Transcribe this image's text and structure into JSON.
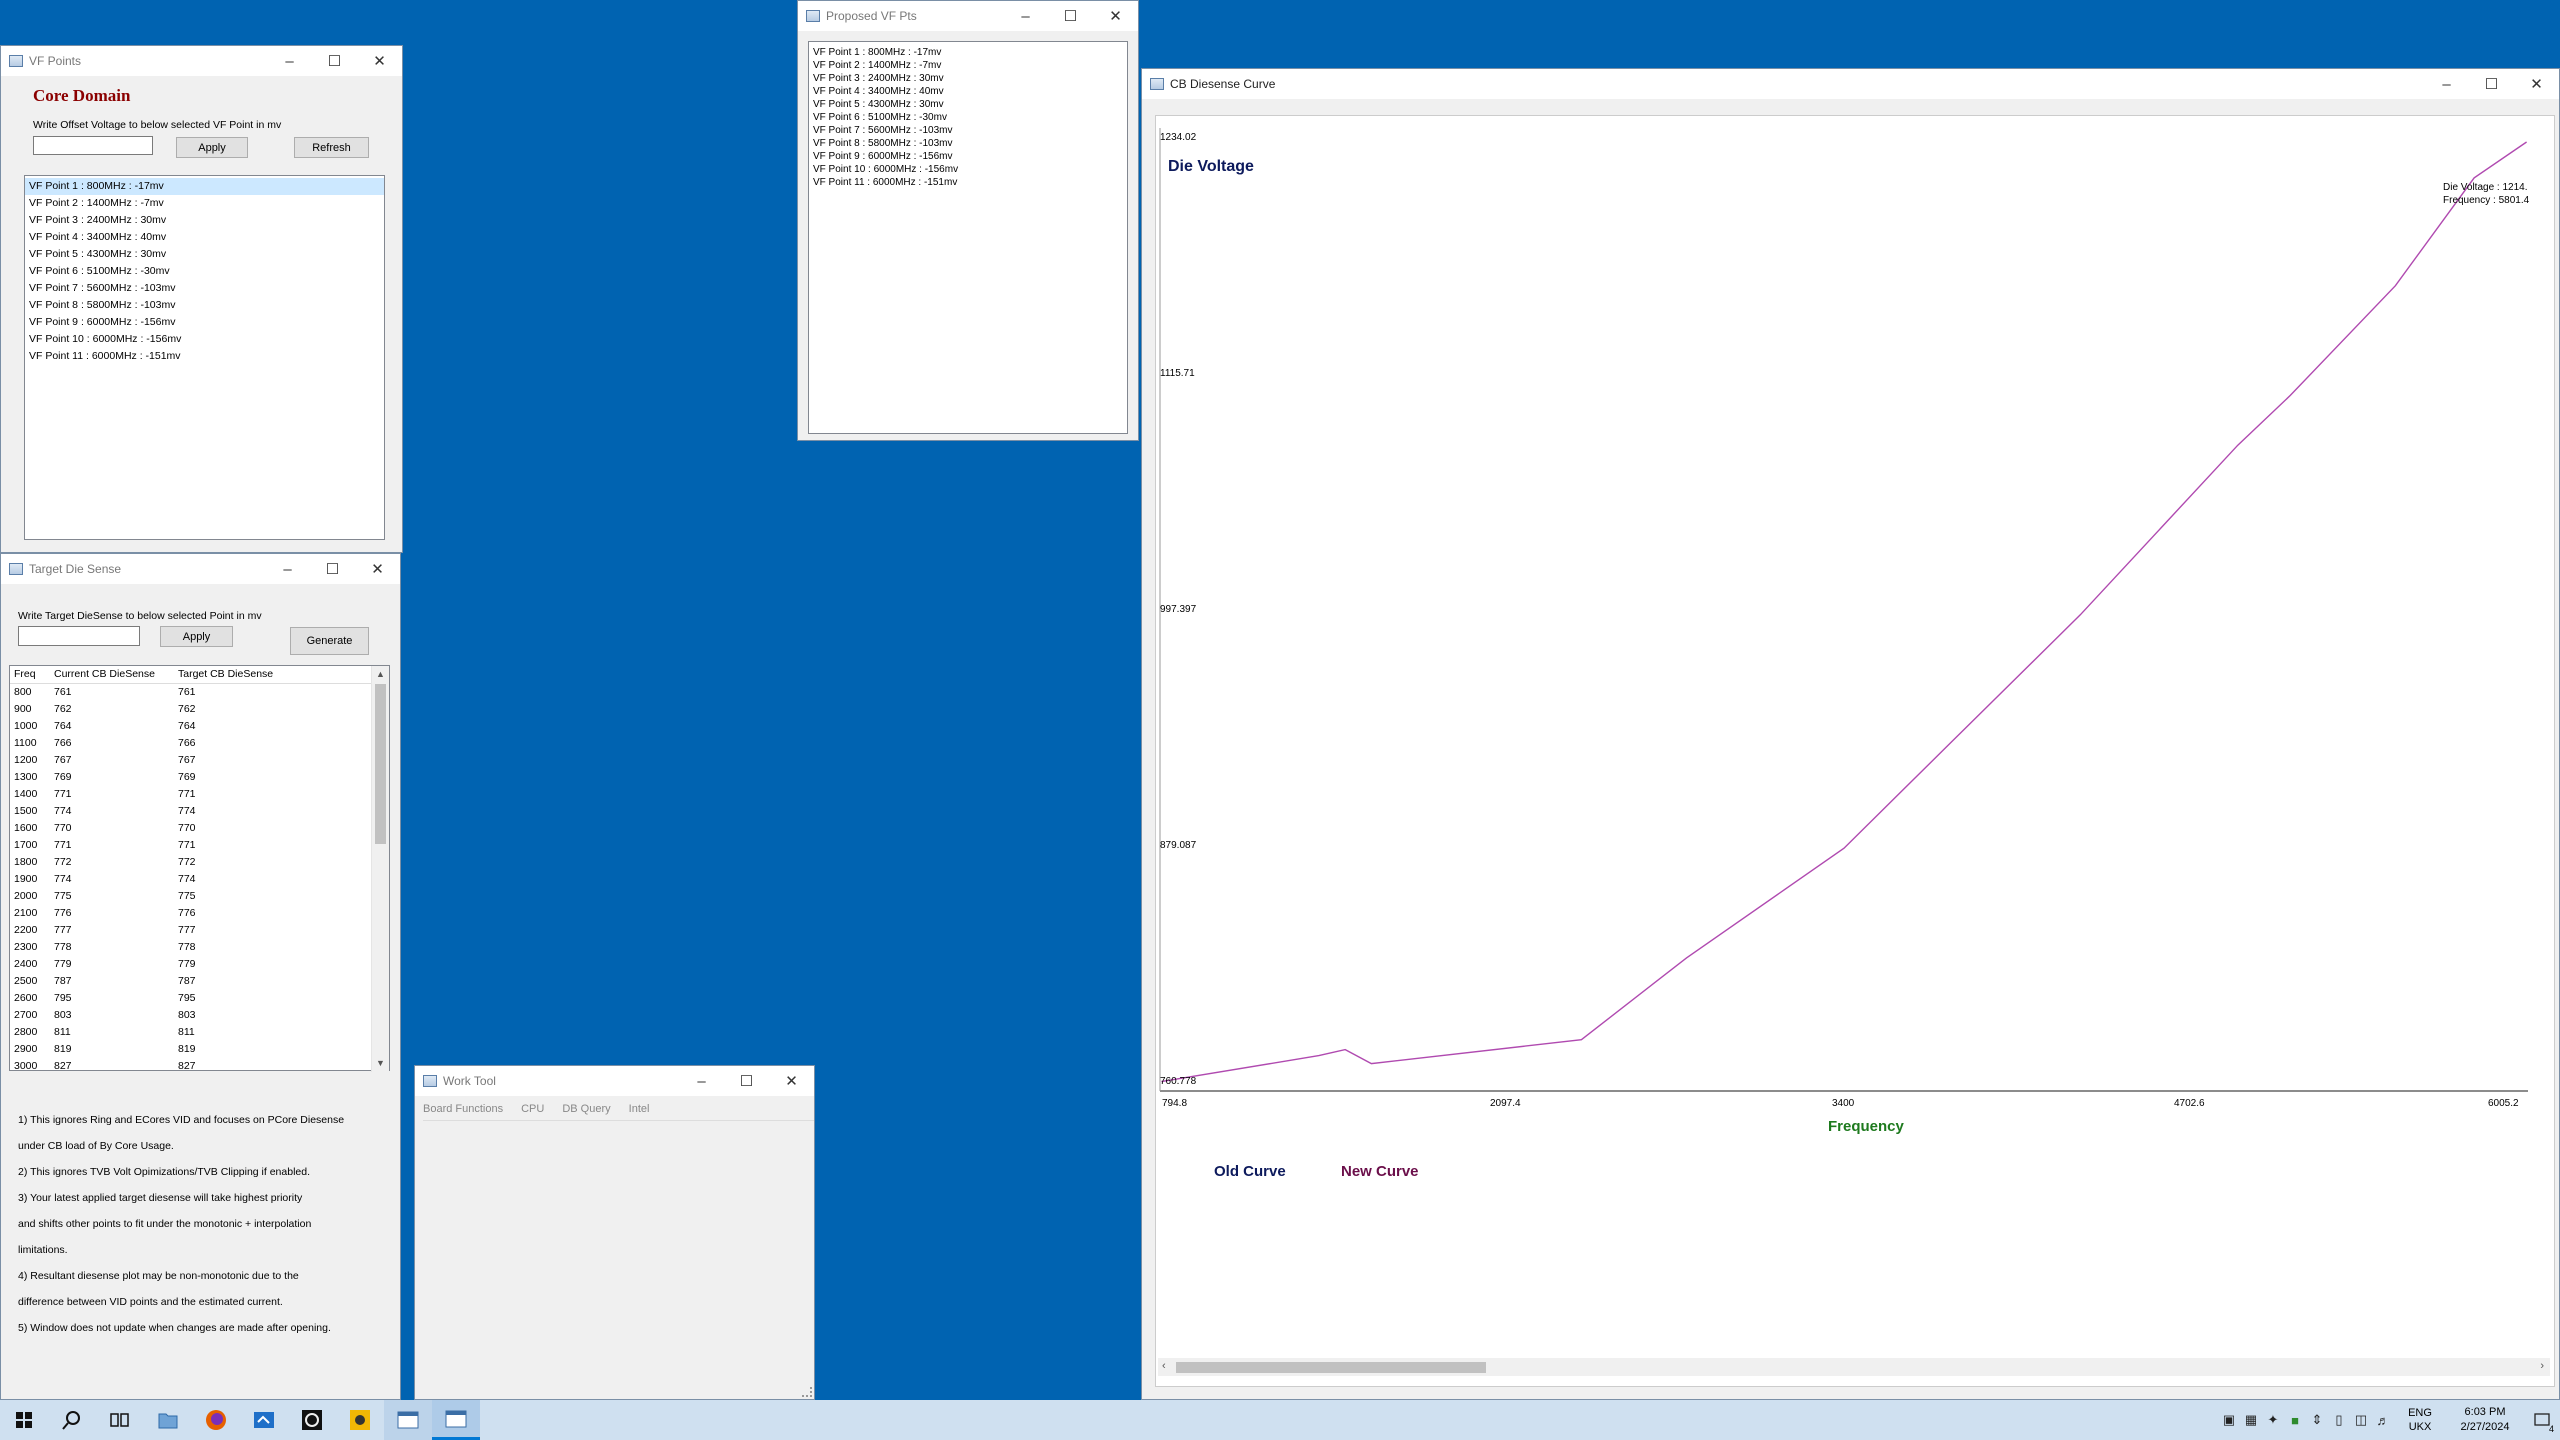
{
  "windows": {
    "vf_points": {
      "title": "VF Points",
      "heading": "Core Domain",
      "instruction": "Write Offset Voltage to below selected VF Point in mv",
      "input_value": "",
      "apply_label": "Apply",
      "refresh_label": "Refresh",
      "items": [
        "VF Point 1 : 800MHz : -17mv",
        "VF Point 2 : 1400MHz : -7mv",
        "VF Point 3 : 2400MHz : 30mv",
        "VF Point 4 : 3400MHz : 40mv",
        "VF Point 5 : 4300MHz : 30mv",
        "VF Point 6 : 5100MHz : -30mv",
        "VF Point 7 : 5600MHz : -103mv",
        "VF Point 8 : 5800MHz : -103mv",
        "VF Point 9 : 6000MHz : -156mv",
        "VF Point 10 : 6000MHz : -156mv",
        "VF Point 11 : 6000MHz : -151mv"
      ]
    },
    "proposed": {
      "title": "Proposed VF Pts",
      "items": [
        "VF Point 1 : 800MHz : -17mv",
        "VF Point 2 : 1400MHz : -7mv",
        "VF Point 3 : 2400MHz : 30mv",
        "VF Point 4 : 3400MHz : 40mv",
        "VF Point 5 : 4300MHz : 30mv",
        "VF Point 6 : 5100MHz : -30mv",
        "VF Point 7 : 5600MHz : -103mv",
        "VF Point 8 : 5800MHz : -103mv",
        "VF Point 9 : 6000MHz : -156mv",
        "VF Point 10 : 6000MHz : -156mv",
        "VF Point 11 : 6000MHz : -151mv"
      ]
    },
    "target": {
      "title": "Target Die Sense",
      "instruction": "Write Target DieSense to below selected Point in mv",
      "input_value": "",
      "apply_label": "Apply",
      "generate_label": "Generate",
      "columns": [
        "Freq",
        "Current CB DieSense",
        "Target CB DieSense"
      ],
      "rows": [
        [
          "800",
          "761",
          "761"
        ],
        [
          "900",
          "762",
          "762"
        ],
        [
          "1000",
          "764",
          "764"
        ],
        [
          "1100",
          "766",
          "766"
        ],
        [
          "1200",
          "767",
          "767"
        ],
        [
          "1300",
          "769",
          "769"
        ],
        [
          "1400",
          "771",
          "771"
        ],
        [
          "1500",
          "774",
          "774"
        ],
        [
          "1600",
          "770",
          "770"
        ],
        [
          "1700",
          "771",
          "771"
        ],
        [
          "1800",
          "772",
          "772"
        ],
        [
          "1900",
          "774",
          "774"
        ],
        [
          "2000",
          "775",
          "775"
        ],
        [
          "2100",
          "776",
          "776"
        ],
        [
          "2200",
          "777",
          "777"
        ],
        [
          "2300",
          "778",
          "778"
        ],
        [
          "2400",
          "779",
          "779"
        ],
        [
          "2500",
          "787",
          "787"
        ],
        [
          "2600",
          "795",
          "795"
        ],
        [
          "2700",
          "803",
          "803"
        ],
        [
          "2800",
          "811",
          "811"
        ],
        [
          "2900",
          "819",
          "819"
        ],
        [
          "3000",
          "827",
          "827"
        ]
      ],
      "notes": [
        "1) This ignores Ring and ECores VID and focuses on PCore Diesense",
        "under CB load of By Core Usage.",
        "2) This ignores TVB Volt Opimizations/TVB Clipping if enabled.",
        "3) Your latest applied target diesense will take highest priority",
        "and shifts other points to fit under the monotonic + interpolation",
        "limitations.",
        "4) Resultant diesense plot may be non-monotonic due to the",
        "difference between VID points and the estimated current.",
        "5) Window does not update when changes are made after opening."
      ]
    },
    "work_tool": {
      "title": "Work Tool",
      "menu": [
        "Board Functions",
        "CPU",
        "DB Query",
        "Intel"
      ]
    },
    "curve": {
      "title": "CB Diesense Curve",
      "legend_old": "Old Curve",
      "legend_new": "New Curve",
      "tooltip_line1": "Die Voltage : 1214.",
      "tooltip_line2": "Frequency : 5801.4",
      "colors": {
        "new_curve": "#b04ab0",
        "old_curve": "#0d1a5c",
        "ylabel": "#0d1a5c",
        "xlabel": "#1e7a1e",
        "new_legend": "#6b0f4a"
      }
    }
  },
  "chart_data": {
    "type": "line",
    "title": "",
    "xlabel": "Frequency",
    "ylabel": "Die Voltage",
    "xlim": [
      794.8,
      6005.2
    ],
    "ylim": [
      760.778,
      1234.02
    ],
    "x_ticks": [
      "794.8",
      "2097.4",
      "3400",
      "4702.6",
      "6005.2"
    ],
    "y_ticks": [
      "1234.02",
      "1115.71",
      "997.397",
      "879.087",
      "760.778"
    ],
    "legend": [
      "Old Curve",
      "New Curve"
    ],
    "series": [
      {
        "name": "New Curve",
        "x": [
          800,
          1400,
          1500,
          1600,
          2400,
          2800,
          3400,
          3800,
          4300,
          4900,
          5100,
          5500,
          5800,
          6000
        ],
        "y": [
          761,
          774,
          777,
          770,
          782,
          823,
          878,
          930,
          995,
          1080,
          1105,
          1160,
          1214,
          1232
        ]
      }
    ]
  },
  "taskbar": {
    "lang": "ENG",
    "region": "UKX",
    "time": "6:03 PM",
    "date": "2/27/2024",
    "notification_count": "4"
  }
}
